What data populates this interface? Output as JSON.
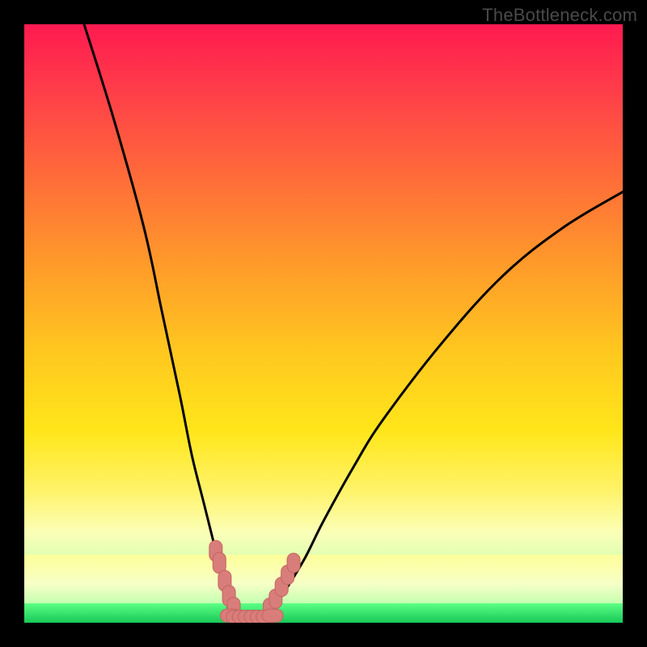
{
  "watermark": {
    "text": "TheBottleneck.com"
  },
  "colors": {
    "frame": "#000000",
    "curve": "#000000",
    "marker_fill": "#d87d7a",
    "marker_stroke": "#c46562",
    "gradient_top": "#ff1a50",
    "gradient_mid": "#ffc81f",
    "gradient_low": "#fbffb8",
    "green": "#17c958"
  },
  "chart_data": {
    "type": "line",
    "title": "",
    "xlabel": "",
    "ylabel": "",
    "xlim": [
      0,
      100
    ],
    "ylim": [
      0,
      100
    ],
    "grid": false,
    "legend": false,
    "series": [
      {
        "name": "left-curve",
        "x": [
          10,
          15,
          20,
          23,
          26,
          28,
          30,
          32,
          33,
          34,
          35,
          36
        ],
        "values": [
          100,
          84,
          66,
          52,
          38,
          28,
          20,
          12,
          8,
          5,
          2.5,
          1
        ]
      },
      {
        "name": "right-curve",
        "x": [
          40,
          42,
          44,
          47,
          50,
          55,
          60,
          70,
          80,
          90,
          100
        ],
        "values": [
          1,
          3,
          6,
          11,
          17,
          26,
          34,
          47,
          58,
          66,
          72
        ]
      },
      {
        "name": "valley-floor",
        "x": [
          34,
          35,
          36,
          37,
          38,
          39,
          40,
          41,
          42
        ],
        "values": [
          2.5,
          1.5,
          1,
          1,
          1,
          1,
          1,
          1.5,
          2.5
        ]
      }
    ],
    "markers": {
      "left_cluster": [
        [
          32,
          12
        ],
        [
          32.6,
          10
        ],
        [
          33.5,
          7
        ],
        [
          34.2,
          4.5
        ],
        [
          35,
          2.5
        ]
      ],
      "right_cluster": [
        [
          41,
          2.5
        ],
        [
          42,
          4
        ],
        [
          43,
          6
        ],
        [
          44,
          8
        ],
        [
          45,
          10
        ]
      ],
      "valley_run": [
        [
          34.5,
          1.2
        ],
        [
          35.5,
          1
        ],
        [
          36.5,
          1
        ],
        [
          37.5,
          1
        ],
        [
          38.5,
          1
        ],
        [
          39.5,
          1
        ],
        [
          40.5,
          1
        ],
        [
          41.5,
          1.2
        ]
      ]
    }
  }
}
